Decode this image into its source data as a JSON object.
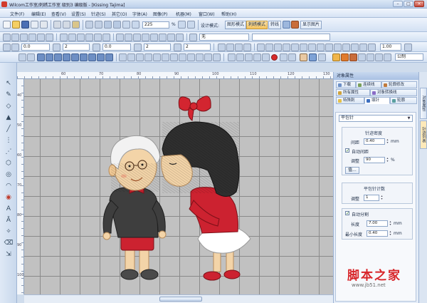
{
  "window": {
    "title": "Wilcom工作室/刺绣工作室 级别3 编级版 - [Kissing          Tajima]",
    "min": "–",
    "max": "□",
    "close": "×"
  },
  "menu": [
    "文件(F)",
    "编辑(E)",
    "查看(V)",
    "设置(S)",
    "针迹(S)",
    "其它(O)",
    "字体(A)",
    "图像(P)",
    "机器(M)",
    "窗口(W)",
    "帮助(H)"
  ],
  "toolbar": {
    "zoom_value": "225",
    "zoom_unit": "%",
    "mode_label": "设计模式:",
    "mode_buttons": [
      "图形模式",
      "刺绣模式",
      "转线",
      "显示图片"
    ],
    "font_value": "无",
    "row2": [
      "0.0",
      "2",
      "0.0",
      "2",
      "2",
      "1.00"
    ],
    "row3_unit": "公制"
  },
  "ruler": {
    "top_labels": [
      "60",
      "70",
      "80",
      "90",
      "100",
      "110",
      "120",
      "130"
    ],
    "left_labels": [
      "40",
      "50",
      "60",
      "70",
      "80",
      "90",
      "100"
    ]
  },
  "panel": {
    "title": "对象属性",
    "tabs_row1": [
      "下载",
      "连续线",
      "轮廓修改"
    ],
    "tabs_row2": [
      "所有属性",
      "对象转换线"
    ],
    "tabs_row3": [
      "特殊刺",
      "填针",
      "轮廓"
    ],
    "stitch_type": "平包针",
    "density_header": "针迹密度",
    "spacing_label": "间距",
    "spacing_value": "0.40",
    "spacing_unit": "mm",
    "auto_spacing_label": "自动间距",
    "auto_spacing_checked": true,
    "adjust_label": "调整",
    "adjust_value": "90",
    "adjust_unit": "%",
    "value_button": "值...",
    "count_header": "平包针计数",
    "count_label": "调整",
    "count_value": "1",
    "auto_split_label": "自动分割",
    "auto_split_checked": true,
    "length_label": "长度",
    "length_value": "7.00",
    "length_unit": "mm",
    "minlen_label": "最小长度",
    "minlen_value": "0.40",
    "minlen_unit": "mm"
  },
  "side_tabs": [
    "对象属性",
    "针迹列表"
  ],
  "watermark": {
    "text": "脚本之家",
    "url": "www.jb51.net"
  },
  "colors": {
    "hair_red": "#d32530",
    "skirt_red": "#cc2230",
    "sweater": "#3e3e3e",
    "skin": "#f3d4a8",
    "canvas": "#c1c1c1"
  }
}
